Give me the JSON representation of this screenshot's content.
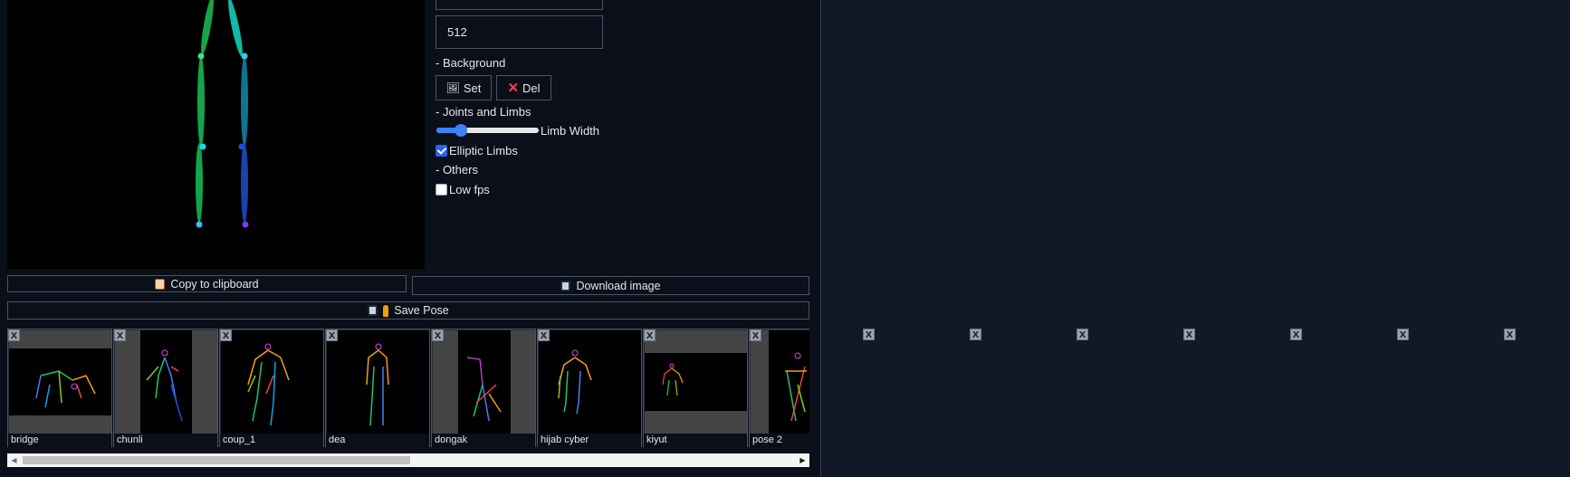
{
  "controls": {
    "width_value": "",
    "height_value": "512",
    "background_label": "- Background",
    "set_label": "Set",
    "del_label": "Del",
    "joints_label": "- Joints and Limbs",
    "limb_width_label": "Limb Width",
    "limb_width_fraction": 0.2,
    "elliptic_label": "Elliptic Limbs",
    "elliptic_checked": true,
    "others_label": "- Others",
    "low_fps_label": "Low fps",
    "low_fps_checked": false
  },
  "actions": {
    "copy_label": "Copy to clipboard",
    "download_label": "Download image",
    "save_pose_label": "Save Pose"
  },
  "gallery": {
    "close_label": "X",
    "items": [
      "bridge",
      "chunli",
      "coup_1",
      "dea",
      "dongak",
      "hijab cyber",
      "kiyut",
      "pose 2"
    ]
  },
  "colors": {
    "background": "#0b0f19",
    "right_panel": "#111827",
    "accent": "#3b82f6",
    "del_icon": "#f43f5e"
  }
}
